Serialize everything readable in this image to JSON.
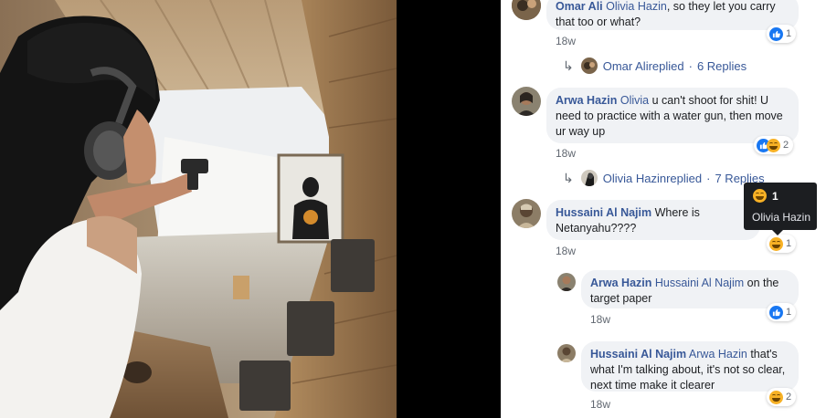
{
  "photo": {
    "description_icon": "shooting-range-photo"
  },
  "comments": [
    {
      "author": "Omar Ali",
      "mention": "Olivia Hazin",
      "text": ", so they let you carry that too or what?",
      "time": "18w",
      "reactions": {
        "types": [
          "like"
        ],
        "count": "1"
      }
    },
    {
      "author": "Arwa Hazin",
      "mention": "Olivia",
      "text": " u can't shoot for shit! U need to practice with a water gun, then move ur way up",
      "time": "18w",
      "reactions": {
        "types": [
          "like",
          "haha"
        ],
        "count": "2"
      }
    },
    {
      "author": "Hussaini Al Najim",
      "mention": "",
      "text": " Where is Netanyahu????",
      "time": "18w",
      "reactions": {
        "types": [
          "haha"
        ],
        "count": "1"
      }
    }
  ],
  "reply_threads": [
    {
      "replier": "Omar Ali",
      "replied_word": " replied",
      "dot": "·",
      "count_text": "6 Replies"
    },
    {
      "replier": "Olivia Hazin",
      "replied_word": " replied",
      "dot": "·",
      "count_text": "7 Replies"
    }
  ],
  "replies": [
    {
      "author": "Arwa Hazin",
      "mention": "Hussaini Al Najim",
      "text": " on the target paper",
      "time": "18w",
      "reactions": {
        "types": [
          "like"
        ],
        "count": "1"
      }
    },
    {
      "author": "Hussaini Al Najim",
      "mention": "Arwa Hazin",
      "text": " that's what I'm talking about, it's not so clear, next time make it clearer",
      "time": "18w",
      "reactions": {
        "types": [
          "haha"
        ],
        "count": "2"
      }
    }
  ],
  "tooltip": {
    "count": "1",
    "name": "Olivia Hazin",
    "reaction": "haha"
  },
  "colors": {
    "link": "#385898",
    "bubble": "#f0f2f5",
    "like": "#1877f2",
    "haha": "#f7b125"
  }
}
